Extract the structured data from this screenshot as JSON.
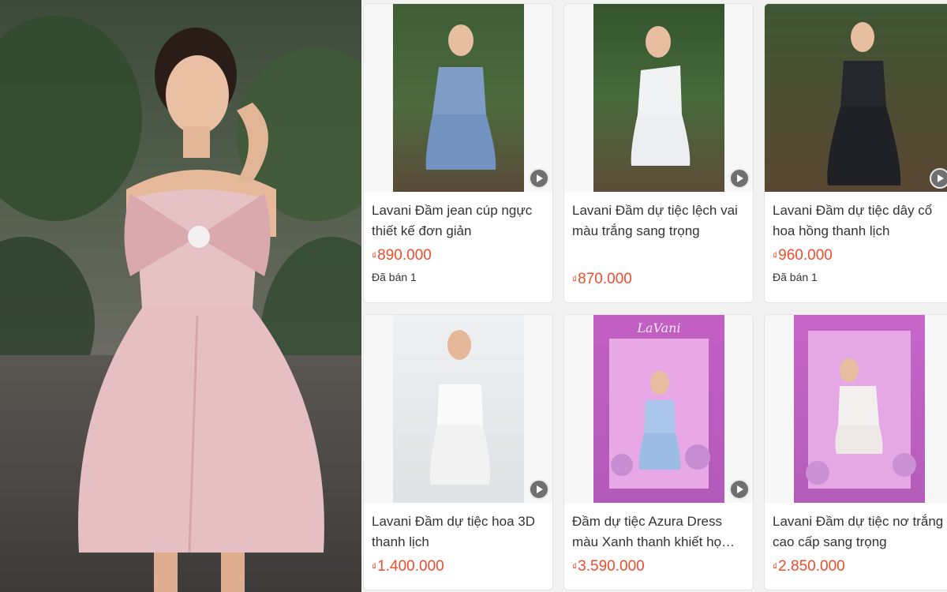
{
  "products": [
    {
      "title": "Lavani Đầm jean cúp ngực thiết kế đơn giản",
      "currency": "₫",
      "price": "890.000",
      "sold": "Đã bán 1"
    },
    {
      "title": "Lavani Đầm dự tiệc lệch vai màu trắng sang trọng",
      "currency": "₫",
      "price": "870.000",
      "sold": ""
    },
    {
      "title": "Lavani Đầm dự tiệc dây cổ hoa hồng thanh lịch",
      "currency": "₫",
      "price": "960.000",
      "sold": "Đã bán 1"
    },
    {
      "title": "Lavani Đầm dự tiệc hoa 3D thanh lịch",
      "currency": "₫",
      "price": "1.400.000",
      "sold": ""
    },
    {
      "title": "Đầm dự tiệc Azura Dress màu Xanh thanh khiết họ…",
      "currency": "₫",
      "price": "3.590.000",
      "sold": ""
    },
    {
      "title": "Lavani Đầm dự tiệc nơ trắng cao cấp sang trọng",
      "currency": "₫",
      "price": "2.850.000",
      "sold": ""
    }
  ],
  "brand_watermark": "LaVani",
  "colors": {
    "price": "#ee4d2d",
    "play_button": "#6f6f6f"
  }
}
